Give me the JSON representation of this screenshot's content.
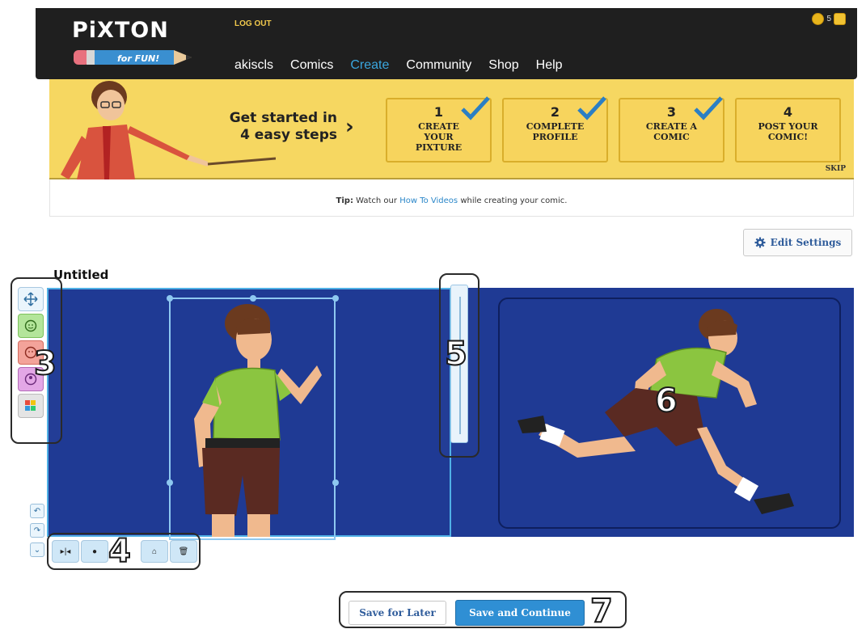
{
  "header": {
    "logo_text": "PiXTON",
    "logo_sub": "for FUN!",
    "logout": "LOG OUT",
    "coins_count": "5",
    "nav": [
      "akiscls",
      "Comics",
      "Create",
      "Community",
      "Shop",
      "Help"
    ],
    "active_nav": "Create"
  },
  "banner": {
    "heading": "Get started in 4 easy steps",
    "steps": [
      {
        "num": "1",
        "label": "CREATE YOUR PIXTURE",
        "done": true
      },
      {
        "num": "2",
        "label": "COMPLETE PROFILE",
        "done": true
      },
      {
        "num": "3",
        "label": "CREATE A COMIC",
        "done": true
      },
      {
        "num": "4",
        "label": "POST YOUR COMIC!",
        "done": false
      }
    ],
    "skip": "SKIP"
  },
  "tip": {
    "label": "Tip:",
    "before": "Watch our",
    "link": "How To Videos",
    "after": "while creating your comic."
  },
  "edit_settings": "Edit Settings",
  "comic": {
    "title": "Untitled"
  },
  "annotations": {
    "n3": "3",
    "n4": "4",
    "n5": "5",
    "n6": "6",
    "n7": "7"
  },
  "actions": {
    "save_later": "Save for Later",
    "save_continue": "Save and Continue"
  },
  "colors": {
    "panel_bg": "#1f3a94",
    "banner": "#f6d761",
    "accent": "#2f8fd4",
    "check": "#2b7fc4"
  },
  "icons": {
    "vertical_tools": [
      "move-icon",
      "face-icon",
      "expression-icon",
      "pose-icon",
      "color-palette-icon"
    ],
    "horizontal_tools": [
      "flip-icon",
      "front-icon",
      "send-back-icon",
      "trash-icon"
    ]
  }
}
